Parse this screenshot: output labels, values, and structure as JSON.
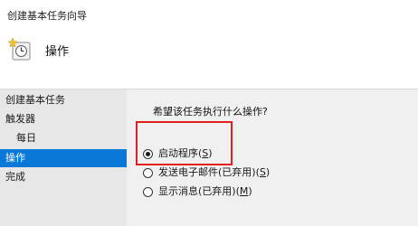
{
  "window": {
    "title": "创建基本任务向导"
  },
  "header": {
    "heading": "操作",
    "icon": "task-scheduler-icon"
  },
  "sidebar": {
    "items": [
      {
        "label": "创建基本任务",
        "active": false
      },
      {
        "label": "触发器",
        "active": false
      },
      {
        "label": "每日",
        "active": false
      },
      {
        "label": "操作",
        "active": true
      },
      {
        "label": "完成",
        "active": false
      }
    ]
  },
  "main": {
    "question": "希望该任务执行什么操作?",
    "options": [
      {
        "label": "启动程序",
        "shortcut": "S",
        "checked": true
      },
      {
        "label": "发送电子邮件(已弃用)",
        "shortcut": "S",
        "checked": false
      },
      {
        "label": "显示消息(已弃用)",
        "shortcut": "M",
        "checked": false
      }
    ]
  },
  "colors": {
    "accent": "#0a78d7",
    "highlight": "#e0201c",
    "sidebar_bg": "#e7e7e7",
    "content_bg": "#f0f0f0"
  }
}
